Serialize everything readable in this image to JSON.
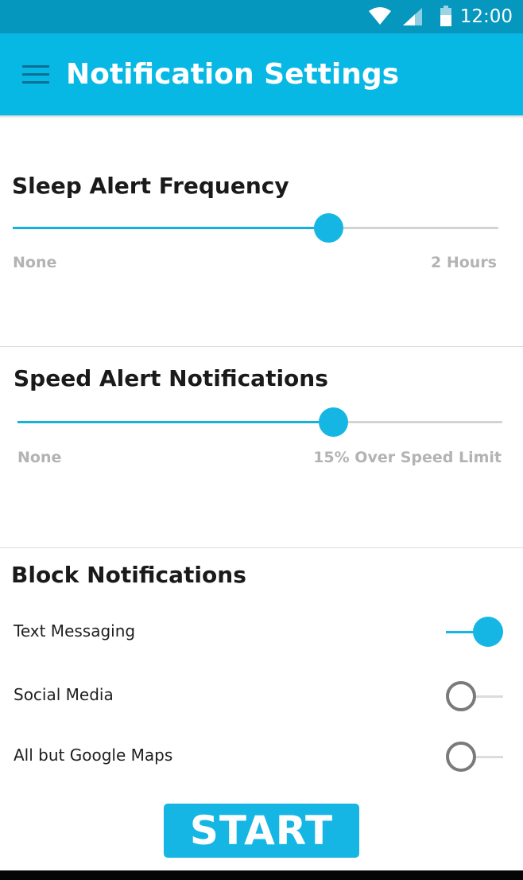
{
  "status_bar": {
    "time": "12:00",
    "icons": [
      "wifi-icon",
      "signal-icon",
      "battery-icon"
    ],
    "background": "#0597bd"
  },
  "app_bar": {
    "title": "Notification Settings",
    "menu_icon": "hamburger-menu-icon",
    "background": "#08b8e4"
  },
  "sleep_alert": {
    "title": "Sleep Alert Frequency",
    "min_label": "None",
    "max_label": "2 Hours",
    "value_fraction": 0.65
  },
  "speed_alert": {
    "title": "Speed Alert Notifications",
    "min_label": "None",
    "max_label": "15% Over Speed Limit",
    "value_fraction": 0.65
  },
  "block_notifications": {
    "title": "Block Notifications",
    "items": [
      {
        "label": "Text Messaging",
        "enabled": true
      },
      {
        "label": "Social Media",
        "enabled": false
      },
      {
        "label": "All but Google Maps",
        "enabled": false
      }
    ]
  },
  "start_button": {
    "label": "START"
  },
  "colors": {
    "accent": "#16b6e4",
    "track": "#d3d3d3",
    "label_gray": "#b3b3b3"
  }
}
